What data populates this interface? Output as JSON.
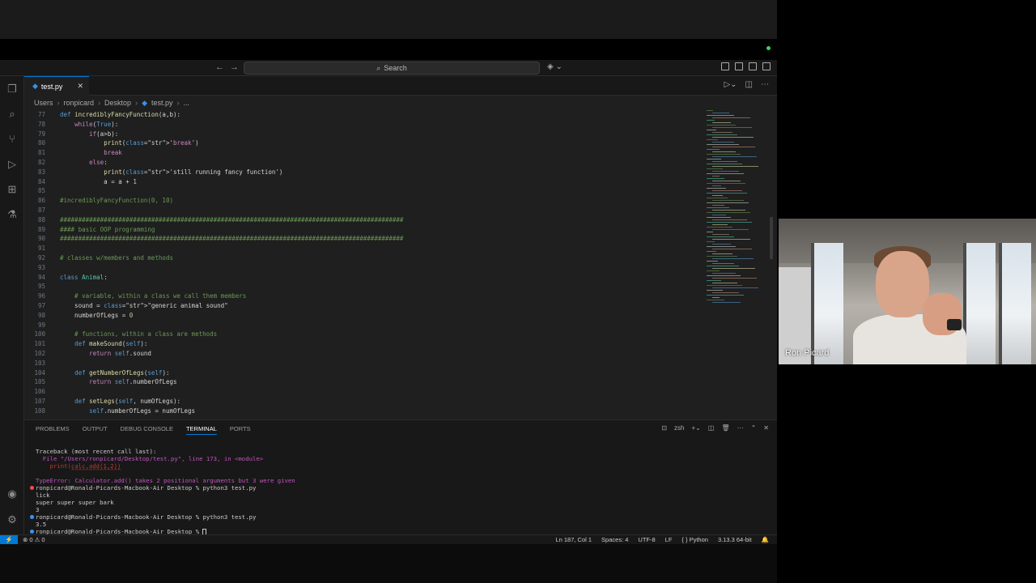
{
  "titlebar": {
    "search_label": "Search",
    "nav_back": "←",
    "nav_forward": "→"
  },
  "tab": {
    "label": "test.py",
    "close": "✕"
  },
  "breadcrumb": [
    "Users",
    "ronpicard",
    "Desktop",
    "test.py",
    "..."
  ],
  "editor": {
    "lines": [
      {
        "n": "77",
        "t": "def incrediblyFancyFunction(a,b):"
      },
      {
        "n": "78",
        "t": "    while(True):"
      },
      {
        "n": "79",
        "t": "        if(a>b):"
      },
      {
        "n": "80",
        "t": "            print('break')"
      },
      {
        "n": "81",
        "t": "            break"
      },
      {
        "n": "82",
        "t": "        else:"
      },
      {
        "n": "83",
        "t": "            print('still running fancy function')"
      },
      {
        "n": "84",
        "t": "            a = a + 1"
      },
      {
        "n": "85",
        "t": ""
      },
      {
        "n": "86",
        "t": "#incrediblyFancyFunction(0, 10)"
      },
      {
        "n": "87",
        "t": ""
      },
      {
        "n": "88",
        "t": "##############################################################################################"
      },
      {
        "n": "89",
        "t": "#### basic OOP programming"
      },
      {
        "n": "90",
        "t": "##############################################################################################"
      },
      {
        "n": "91",
        "t": ""
      },
      {
        "n": "92",
        "t": "# classes w/members and methods"
      },
      {
        "n": "93",
        "t": ""
      },
      {
        "n": "94",
        "t": "class Animal:"
      },
      {
        "n": "95",
        "t": ""
      },
      {
        "n": "96",
        "t": "    # variable, within a class we call them members"
      },
      {
        "n": "97",
        "t": "    sound = \"generic animal sound\""
      },
      {
        "n": "98",
        "t": "    numberOfLegs = 0"
      },
      {
        "n": "99",
        "t": ""
      },
      {
        "n": "100",
        "t": "    # functions, within a class are methods"
      },
      {
        "n": "101",
        "t": "    def makeSound(self):"
      },
      {
        "n": "102",
        "t": "        return self.sound"
      },
      {
        "n": "103",
        "t": ""
      },
      {
        "n": "104",
        "t": "    def getNumberOfLegs(self):"
      },
      {
        "n": "105",
        "t": "        return self.numberOfLegs"
      },
      {
        "n": "106",
        "t": ""
      },
      {
        "n": "107",
        "t": "    def setLegs(self, numOfLegs):"
      },
      {
        "n": "108",
        "t": "        self.numberOfLegs = numOfLegs"
      }
    ]
  },
  "panel": {
    "tabs": [
      "PROBLEMS",
      "OUTPUT",
      "DEBUG CONSOLE",
      "TERMINAL",
      "PORTS"
    ],
    "active_tab": "TERMINAL",
    "shell": "zsh",
    "terminal_lines": [
      "Traceback (most recent call last):",
      "  File \"/Users/ronpicard/Desktop/test.py\", line 173, in <module>",
      "    print(calc.add(1,2))",
      "          ^^^^^^^^^^^^^^",
      "TypeError: Calculator.add() takes 2 positional arguments but 3 were given",
      "ronpicard@Ronald-Picards-Macbook-Air Desktop % python3 test.py",
      "lick",
      "super super super bark",
      "3",
      "ronpicard@Ronald-Picards-Macbook-Air Desktop % python3 test.py",
      "3.5",
      "ronpicard@Ronald-Picards-Macbook-Air Desktop % "
    ]
  },
  "statusbar": {
    "problems": "⊗ 0 ⚠ 0",
    "position": "Ln 187, Col 1",
    "spaces": "Spaces: 4",
    "encoding": "UTF-8",
    "eol": "LF",
    "language": "{ } Python",
    "interpreter": "3.13.3 64-bit"
  },
  "webcam": {
    "name": "Ron Picard"
  },
  "colors": {
    "accent": "#0078d4",
    "background": "#1f1f1f"
  }
}
